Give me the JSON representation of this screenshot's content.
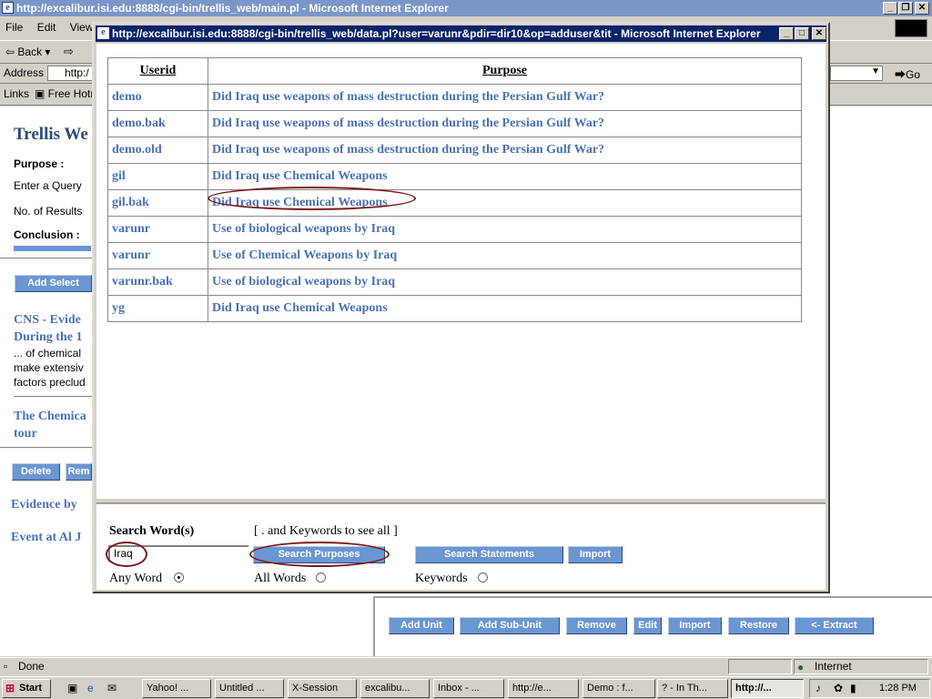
{
  "main_window": {
    "title": "http://excalibur.isi.edu:8888/cgi-bin/trellis_web/main.pl - Microsoft Internet Explorer",
    "menu": [
      "File",
      "Edit",
      "View"
    ],
    "back_label": "Back",
    "address_label": "Address",
    "address_value": "http:/",
    "go_label": "Go",
    "links_label": "Links",
    "links_item": "Free Hotm"
  },
  "main_page": {
    "title": "Trellis We",
    "purpose_label": "Purpose :",
    "enter_query": "Enter a Query",
    "num_results": "No. of Results",
    "conclusion_label": "Conclusion :",
    "add_selected": "Add Select",
    "result1_title_a": "CNS - Evide",
    "result1_title_b": "During the 1",
    "result1_snip_a": "... of chemical",
    "result1_snip_b": "make extensiv",
    "result1_snip_c": "factors preclud",
    "result2_title_a": "The Chemica",
    "result2_title_b": "tour",
    "delete_label": "Delete",
    "rem_label": "Rem",
    "evidence_by": "Evidence by",
    "event_at": "Event at Al J",
    "bottom_buttons": [
      "Add Unit",
      "Add Sub-Unit",
      "Remove",
      "Edit",
      "Import",
      "Restore",
      "<- Extract"
    ]
  },
  "status": {
    "text": "Done",
    "zone": "Internet"
  },
  "taskbar": {
    "start": "Start",
    "items": [
      "Yahoo! ...",
      "Untitled ...",
      "X-Session",
      "excalibu...",
      "Inbox - ...",
      "http://e...",
      "Demo : f...",
      "? - In Th...",
      "http://..."
    ],
    "active_index": 8,
    "clock": "1:28 PM"
  },
  "popup": {
    "title": "http://excalibur.isi.edu:8888/cgi-bin/trellis_web/data.pl?user=varunr&pdir=dir10&op=adduser&tit - Microsoft Internet Explorer",
    "col_userid": "Userid",
    "col_purpose": "Purpose",
    "rows": [
      {
        "userid": "demo",
        "purpose": "Did Iraq use weapons of mass destruction during the Persian Gulf War?"
      },
      {
        "userid": "demo.bak",
        "purpose": "Did Iraq use weapons of mass destruction during the Persian Gulf War?"
      },
      {
        "userid": "demo.old",
        "purpose": "Did Iraq use weapons of mass destruction during the Persian Gulf War?"
      },
      {
        "userid": "gil",
        "purpose": "Did Iraq use Chemical Weapons"
      },
      {
        "userid": "gil.bak",
        "purpose": "Did Iraq use Chemical Weapons"
      },
      {
        "userid": "varunr",
        "purpose": "Use of biological weapons by Iraq"
      },
      {
        "userid": "varunr",
        "purpose": "Use of Chemical Weapons by Iraq"
      },
      {
        "userid": "varunr.bak",
        "purpose": "Use of biological weapons by Iraq"
      },
      {
        "userid": "yg",
        "purpose": "Did Iraq use Chemical Weapons"
      }
    ],
    "search_label": "Search Word(s)",
    "hint": "[ . and Keywords to see all ]",
    "search_value": "Iraq",
    "search_purposes": "Search Purposes",
    "search_statements": "Search Statements",
    "import": "Import",
    "any_word": "Any Word",
    "all_words": "All Words",
    "keywords": "Keywords"
  }
}
